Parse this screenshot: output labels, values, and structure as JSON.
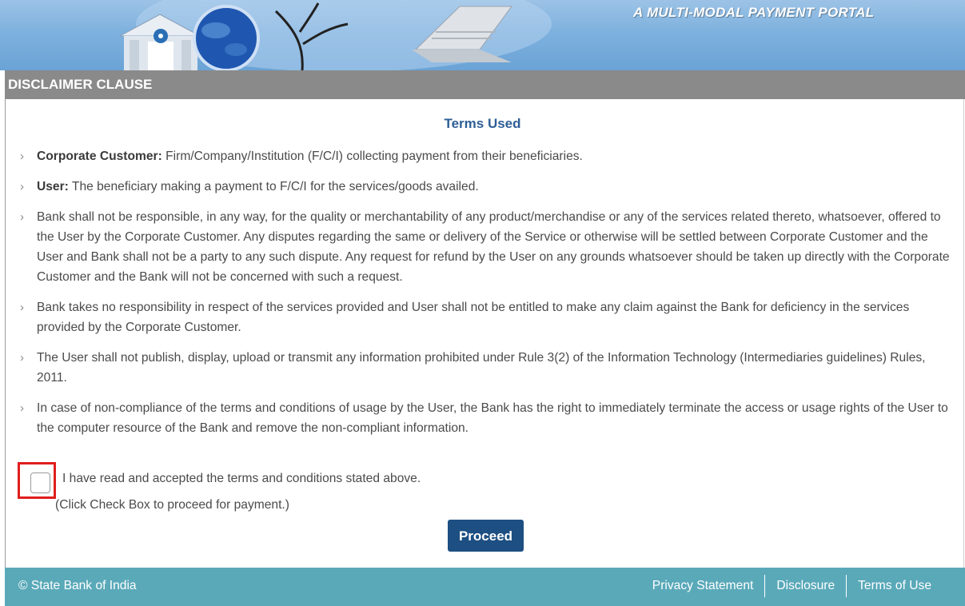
{
  "banner": {
    "tagline": "A MULTI-MODAL PAYMENT PORTAL"
  },
  "header": {
    "title": "DISCLAIMER CLAUSE"
  },
  "main": {
    "heading": "Terms Used",
    "items": [
      {
        "label": "Corporate Customer:",
        "text": " Firm/Company/Institution (F/C/I) collecting payment from their beneficiaries."
      },
      {
        "label": "User:",
        "text": " The beneficiary making a payment to F/C/I for the services/goods availed."
      },
      {
        "label": "",
        "text": "Bank shall not be responsible, in any way, for the quality or merchantability of any product/merchandise or any of the services related thereto, whatsoever, offered to the User by the Corporate Customer. Any disputes regarding the same or delivery of the Service or otherwise will be settled between Corporate Customer and the User and Bank shall not be a party to any such dispute. Any request for refund by the User on any grounds whatsoever should be taken up directly with the Corporate Customer and the Bank will not be concerned with such a request."
      },
      {
        "label": "",
        "text": "Bank takes no responsibility in respect of the services provided and User shall not be entitled to make any claim against the Bank for deficiency in the services provided by the Corporate Customer."
      },
      {
        "label": "",
        "text": "The User shall not publish, display, upload or transmit any information prohibited under Rule 3(2) of the Information Technology (Intermediaries guidelines) Rules, 2011."
      },
      {
        "label": "",
        "text": "In case of non-compliance of the terms and conditions of usage by the User, the Bank has the right to immediately terminate the access or usage rights of the User to the computer resource of the Bank and remove the non-compliant information."
      }
    ],
    "accept_text": "I have read and accepted the terms and conditions stated above.",
    "click_note": "(Click Check Box to proceed for payment.)",
    "checkbox_checked": false,
    "proceed_label": "Proceed"
  },
  "footer": {
    "copyright": "© State Bank of India",
    "links": [
      "Privacy Statement",
      "Disclosure",
      "Terms of Use"
    ]
  },
  "colors": {
    "banner_blue": "#7eb1de",
    "header_gray": "#8a8a8a",
    "heading_blue": "#2d5e96",
    "button_navy": "#1d4f82",
    "footer_teal": "#5aa9b9",
    "highlight_red": "#e01e1e"
  },
  "icons": [
    "bank-building-icon",
    "globe-icon",
    "tree-branch-icon",
    "laptop-icon",
    "chevron-right-icon",
    "checkbox-icon"
  ]
}
